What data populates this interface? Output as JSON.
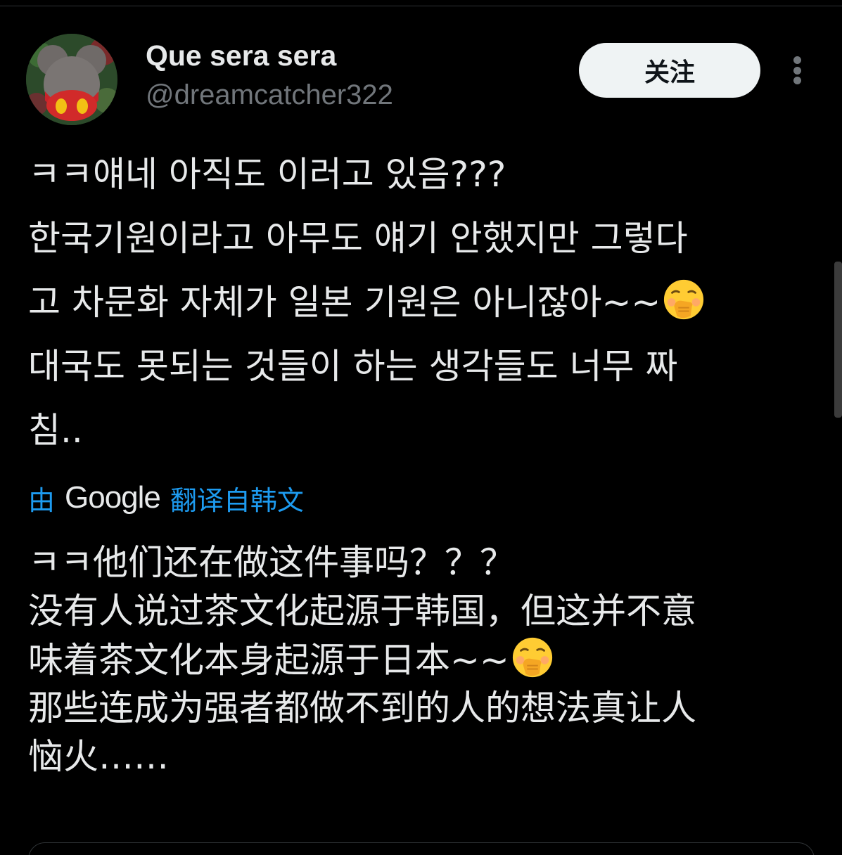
{
  "user": {
    "display_name": "Que sera sera",
    "handle": "@dreamcatcher322"
  },
  "follow_label": "关注",
  "tweet": {
    "lines": [
      "ㅋㅋ얘네 아직도 이러고 있음???",
      "한국기원이라고 아무도 얘기 안했지만 그렇다",
      "고 차문화 자체가 일본 기원은 아니잖아~~",
      "대국도 못되는 것들이 하는 생각들도 너무 짜",
      "침.."
    ]
  },
  "translation_notice": {
    "prefix": "由",
    "provider": "Google",
    "suffix": "翻译自韩文"
  },
  "translation": {
    "lines": [
      "ㅋㅋ他们还在做这件事吗？？？",
      "没有人说过茶文化起源于韩国，但这并不意",
      "味着茶文化本身起源于日本~~",
      "那些连成为强者都做不到的人的想法真让人",
      "恼火……"
    ]
  },
  "icons": {
    "more": "more-vertical-icon",
    "emoji": "hand-over-mouth-emoji"
  },
  "colors": {
    "background": "#000000",
    "text": "#e7e9ea",
    "secondary": "#71767b",
    "link": "#1d9bf0",
    "button_bg": "#eff3f4"
  }
}
